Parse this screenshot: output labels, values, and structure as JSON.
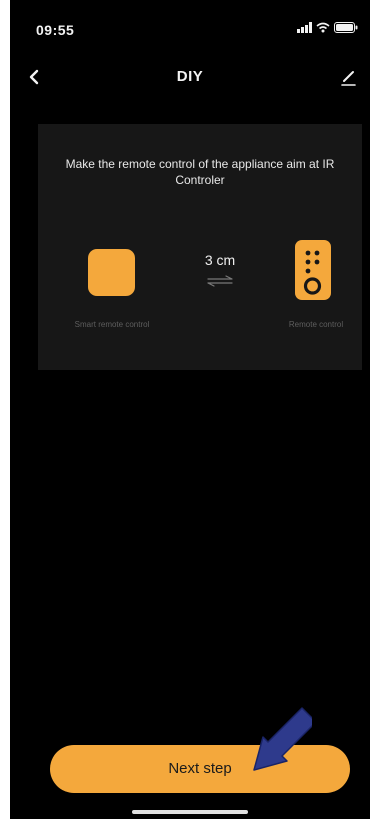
{
  "status_bar": {
    "time": "09:55",
    "icons": [
      "signal-icon",
      "wifi-icon",
      "battery-icon"
    ]
  },
  "nav": {
    "title": "DIY",
    "back_icon": "chevron-left-icon",
    "edit_icon": "pencil-icon"
  },
  "card": {
    "instruction": "Make the remote control of the appliance aim at IR Controler",
    "distance": "3 cm",
    "smart_remote_label": "Smart remote control",
    "remote_label": "Remote control"
  },
  "next_button": {
    "label": "Next step"
  },
  "colors": {
    "background": "#000000",
    "card": "#171717",
    "accent": "#f4a83c",
    "annotation_arrow": "#2e3a8c"
  }
}
